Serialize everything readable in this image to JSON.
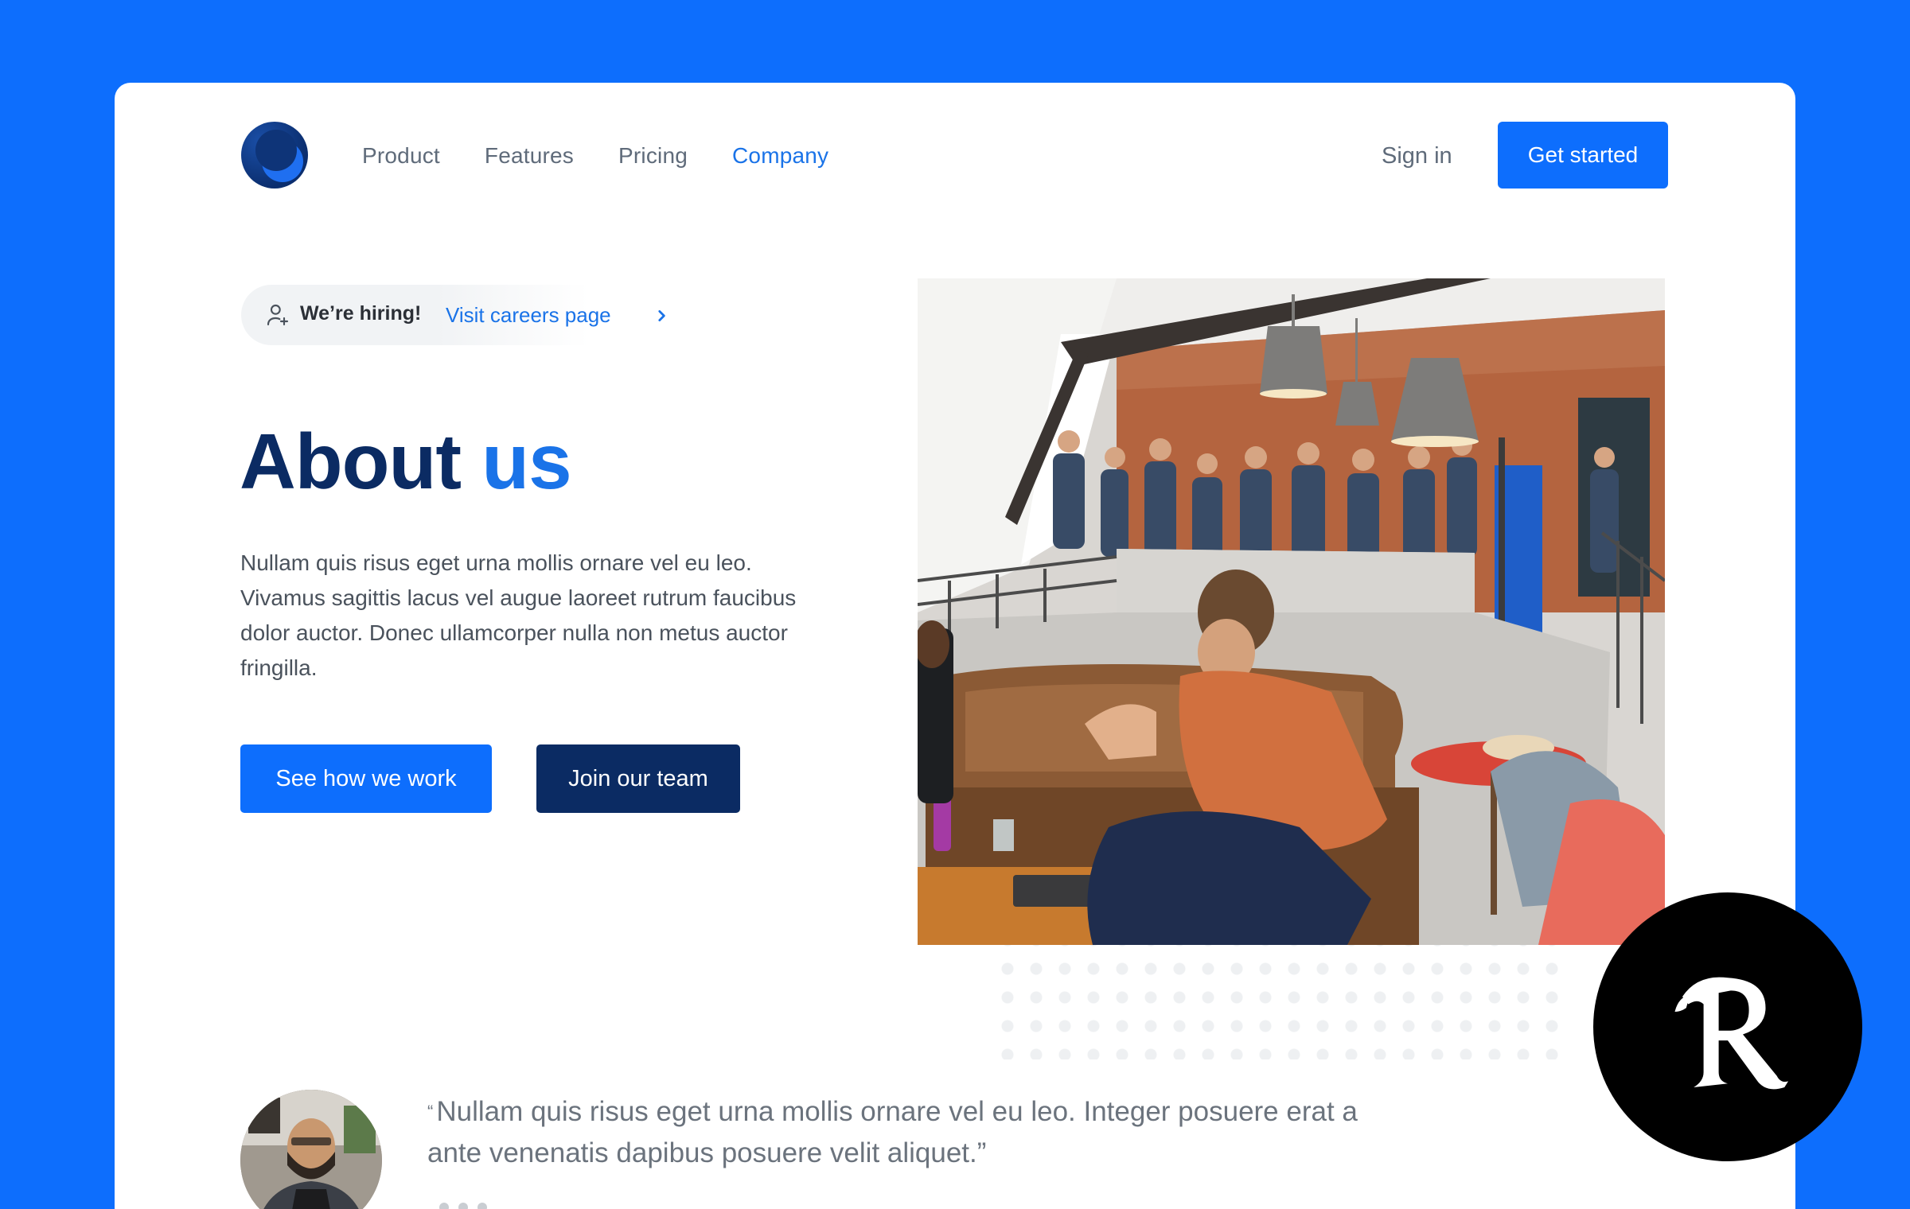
{
  "nav": {
    "items": [
      {
        "label": "Product"
      },
      {
        "label": "Features"
      },
      {
        "label": "Pricing"
      },
      {
        "label": "Company"
      }
    ],
    "active": "Company",
    "sign_in": "Sign in",
    "cta": "Get started"
  },
  "hero": {
    "pill_text": "We’re hiring!",
    "pill_link": "Visit careers page",
    "title_part1": "About",
    "title_part2": "us",
    "description": "Nullam quis risus eget urna mollis ornare vel eu leo. Vivamus sagittis lacus vel augue laoreet rutrum faucibus dolor auctor. Donec ullamcorper nulla non metus auctor fringilla.",
    "primary_button": "See how we work",
    "secondary_button": "Join our team"
  },
  "testimonial": {
    "open_mark": "“",
    "quote": "Nullam quis risus eget urna mollis ornare vel eu leo. Integer posuere erat a ante venenatis dapibus posuere velit aliquet.”"
  },
  "colors": {
    "brand": "#0d6efd",
    "navy": "#0b2b63",
    "link": "#1a73e8"
  },
  "icons": {
    "pill": "user-plus-icon",
    "pill_link": "chevron-right-icon",
    "badge": "blackletter-r-logo"
  }
}
